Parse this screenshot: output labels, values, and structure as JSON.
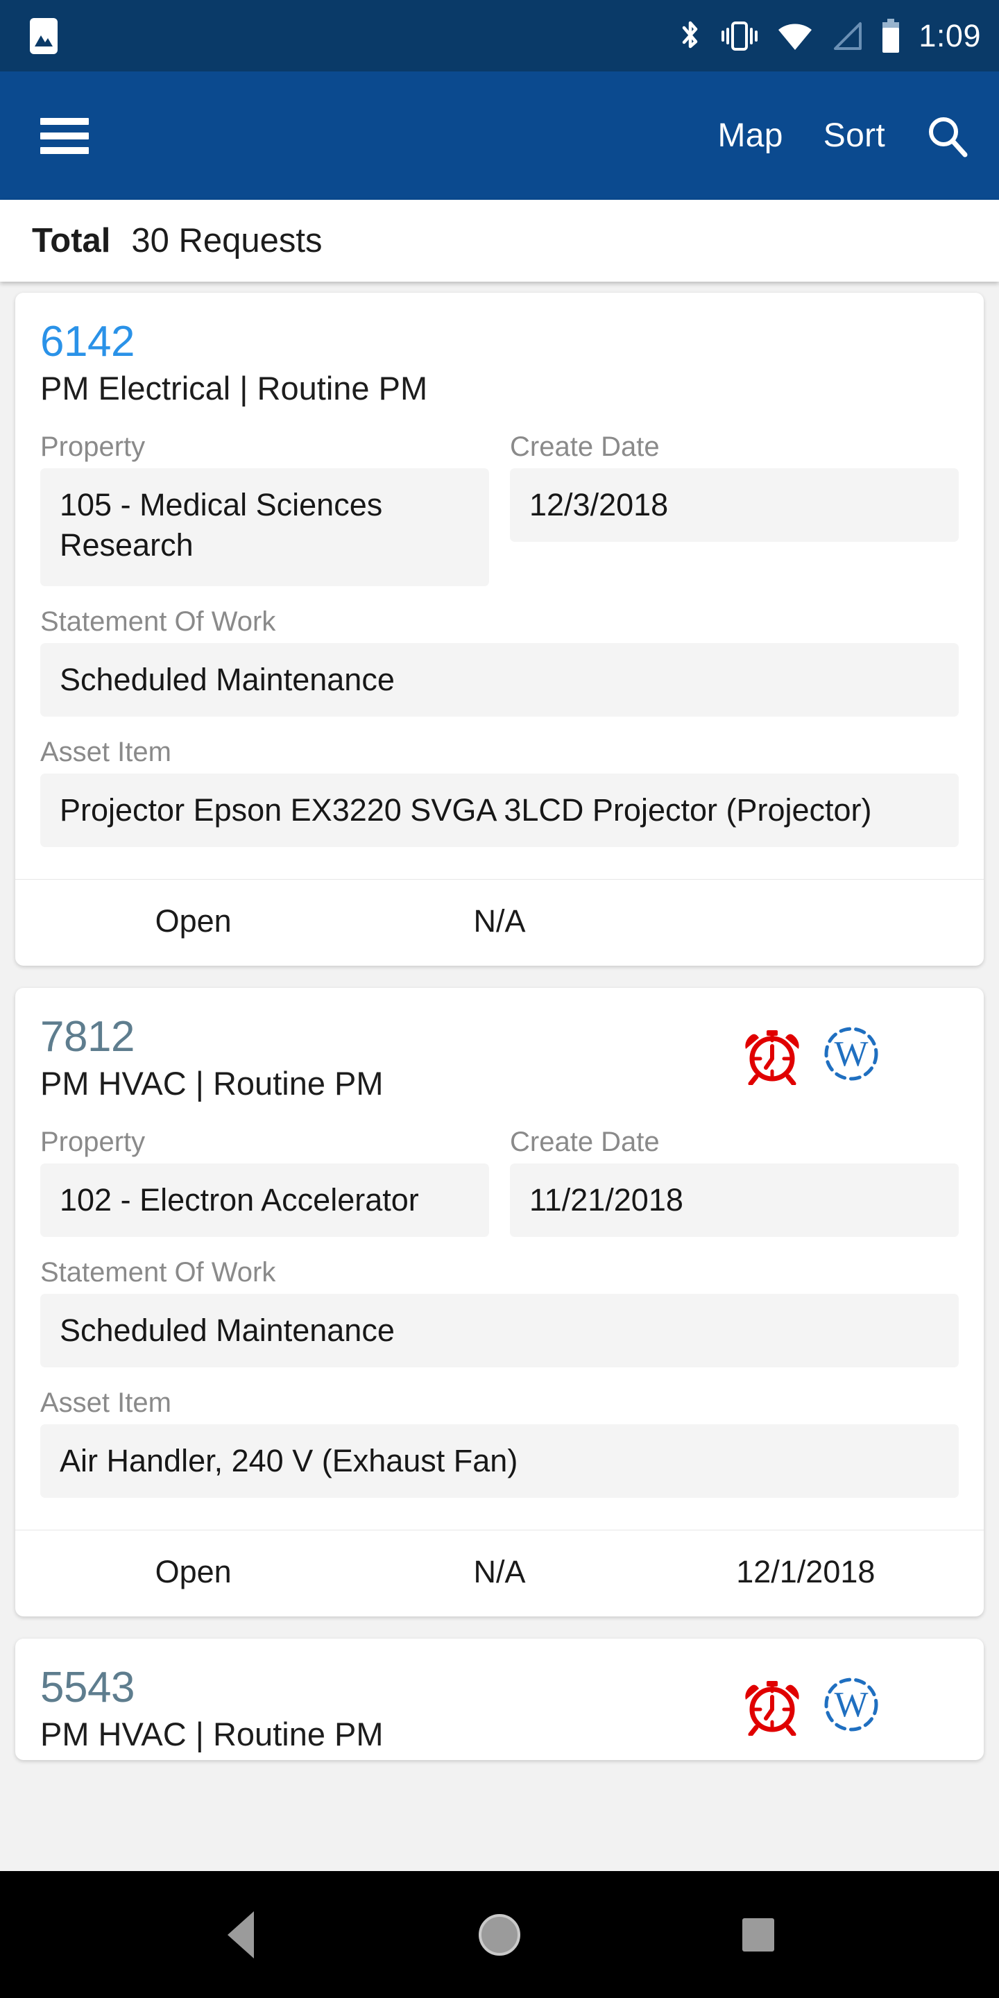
{
  "status_bar": {
    "time": "1:09",
    "icons": [
      "photo-icon",
      "bluetooth-icon",
      "vibrate-icon",
      "wifi-icon",
      "cellular-signal-icon",
      "battery-icon"
    ],
    "background_color": "#0a3a68"
  },
  "app_bar": {
    "menu_icon": "hamburger-menu-icon",
    "map_label": "Map",
    "sort_label": "Sort",
    "search_icon": "search-icon",
    "background_color": "#0b4a8f"
  },
  "summary": {
    "label": "Total",
    "value": "30 Requests"
  },
  "field_labels": {
    "property": "Property",
    "create_date": "Create Date",
    "statement_of_work": "Statement Of Work",
    "asset_item": "Asset Item"
  },
  "accent_colors": {
    "active_request_id": "#2a92e8",
    "muted_request_id": "#5e7d8e",
    "alarm_icon": "#e00000",
    "w_icon": "#1f6fc0",
    "field_background": "#f4f4f4"
  },
  "requests": [
    {
      "id": "6142",
      "id_style": "accent",
      "type": "PM Electrical | Routine PM",
      "icons": [],
      "property": "105 - Medical Sciences Research",
      "property_wraps": true,
      "create_date": "12/3/2018",
      "statement_of_work": "Scheduled Maintenance",
      "asset_item": "Projector Epson EX3220 SVGA 3LCD Projector (Projector)",
      "footer": [
        "Open",
        "N/A",
        ""
      ]
    },
    {
      "id": "7812",
      "id_style": "muted",
      "type": "PM HVAC | Routine PM",
      "icons": [
        "alarm-clock-icon",
        "w-badge-icon"
      ],
      "property": "102 - Electron Accelerator",
      "property_wraps": false,
      "create_date": "11/21/2018",
      "statement_of_work": "Scheduled Maintenance",
      "asset_item": "Air Handler, 240 V (Exhaust Fan)",
      "footer": [
        "Open",
        "N/A",
        "12/1/2018"
      ]
    },
    {
      "id": "5543",
      "id_style": "muted",
      "type": "PM HVAC | Routine PM",
      "icons": [
        "alarm-clock-icon",
        "w-badge-icon"
      ],
      "property": "",
      "property_wraps": false,
      "create_date": "",
      "statement_of_work": "",
      "asset_item": "",
      "footer": []
    }
  ],
  "nav_bar": {
    "back": "back-triangle-icon",
    "home": "home-circle-icon",
    "recents": "recents-square-icon"
  }
}
